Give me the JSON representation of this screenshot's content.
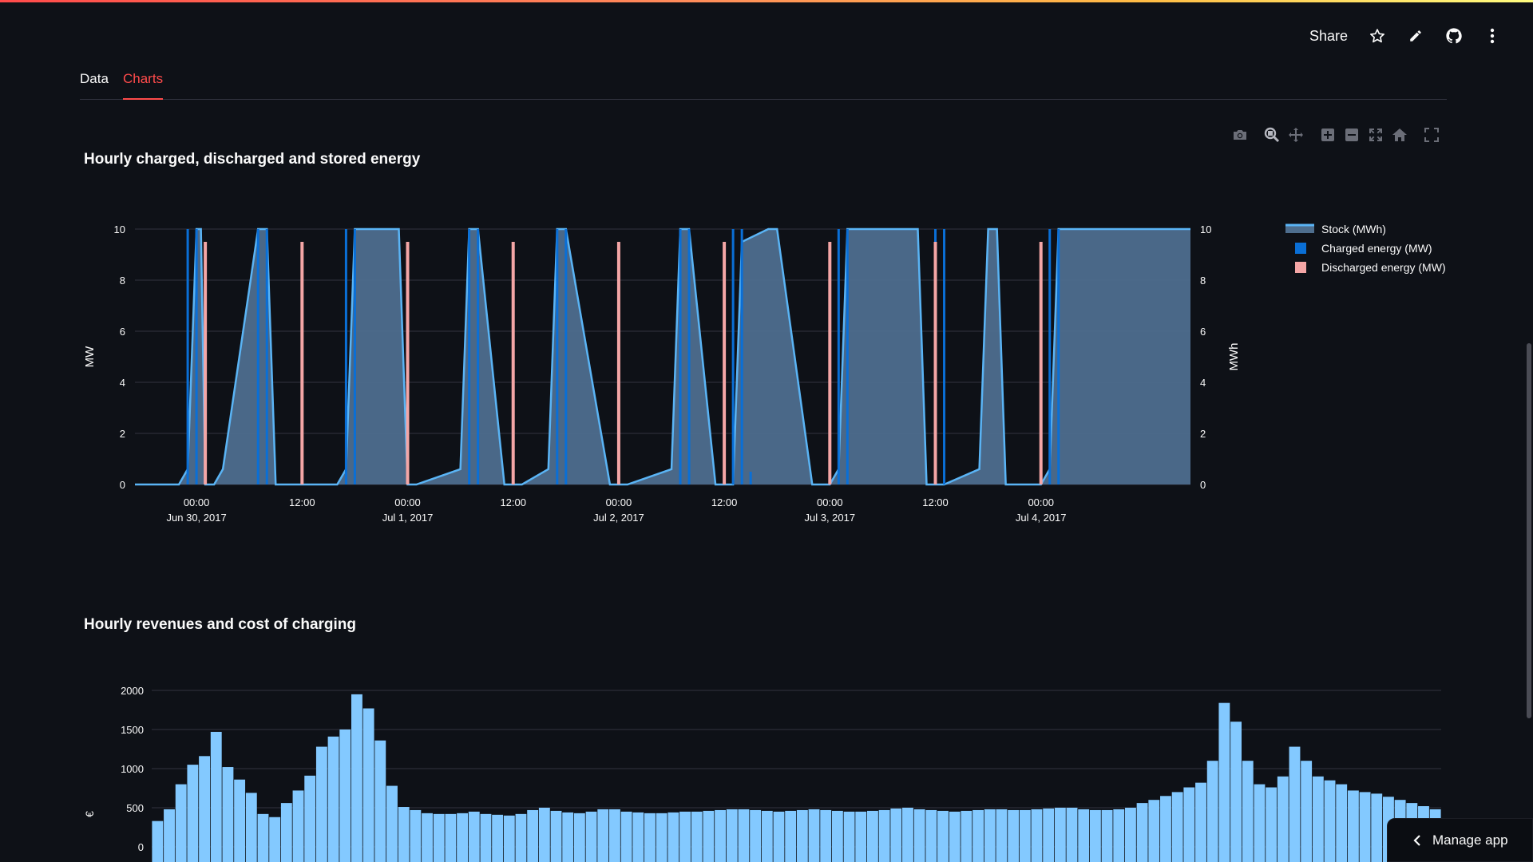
{
  "header": {
    "share_label": "Share",
    "icons": [
      "star-icon",
      "pencil-icon",
      "github-icon",
      "more-vertical-icon"
    ]
  },
  "tabs": [
    {
      "label": "Data",
      "active": false
    },
    {
      "label": "Charts",
      "active": true
    }
  ],
  "modebar": {
    "icons": [
      "camera-icon",
      "zoom-icon",
      "pan-icon",
      "zoom-in-icon",
      "zoom-out-icon",
      "autoscale-icon",
      "home-icon",
      "fullscreen-icon"
    ]
  },
  "colors": {
    "accent": "#ff4b4b",
    "stock": "#5ab4f5",
    "stock_fill": "#4e6e8e",
    "charged": "#0a6fd6",
    "discharged": "#f4a6a6",
    "revenue_bars": "#83c9ff",
    "background": "#0e1117"
  },
  "chart_data": [
    {
      "type": "area",
      "title": "Hourly charged, discharged and stored energy",
      "ylabel": "MW",
      "y2label": "MWh",
      "ylim": [
        0,
        10
      ],
      "y2lim": [
        0,
        10
      ],
      "y_ticks": [
        "0",
        "2",
        "4",
        "6",
        "8",
        "10"
      ],
      "x_range_hours": [
        "2017-06-29 17:00",
        "2017-07-04 17:00"
      ],
      "x_ticks": [
        {
          "t": "2017-06-30 00:00",
          "label": "00:00",
          "date": "Jun 30, 2017"
        },
        {
          "t": "2017-06-30 12:00",
          "label": "12:00",
          "date": ""
        },
        {
          "t": "2017-07-01 00:00",
          "label": "00:00",
          "date": "Jul 1, 2017"
        },
        {
          "t": "2017-07-01 12:00",
          "label": "12:00",
          "date": ""
        },
        {
          "t": "2017-07-02 00:00",
          "label": "00:00",
          "date": "Jul 2, 2017"
        },
        {
          "t": "2017-07-02 12:00",
          "label": "12:00",
          "date": ""
        },
        {
          "t": "2017-07-03 00:00",
          "label": "00:00",
          "date": "Jul 3, 2017"
        },
        {
          "t": "2017-07-03 12:00",
          "label": "12:00",
          "date": ""
        },
        {
          "t": "2017-07-04 00:00",
          "label": "00:00",
          "date": "Jul 4, 2017"
        }
      ],
      "legend": {
        "position": "top-right",
        "entries": [
          "Stock (MWh)",
          "Charged energy (MW)",
          "Discharged energy (MW)"
        ]
      },
      "grid": true,
      "series": [
        {
          "name": "Stock (MWh)",
          "type": "area",
          "x": [
            "2017-06-29 17:00",
            "2017-06-29 22:00",
            "2017-06-29 23:00",
            "2017-06-30 00:00",
            "2017-06-30 00:30",
            "2017-06-30 01:00",
            "2017-06-30 02:00",
            "2017-06-30 03:00",
            "2017-06-30 07:00",
            "2017-06-30 08:00",
            "2017-06-30 09:00",
            "2017-06-30 11:00",
            "2017-06-30 12:00",
            "2017-06-30 16:00",
            "2017-06-30 17:00",
            "2017-06-30 18:00",
            "2017-06-30 23:00",
            "2017-07-01 00:00",
            "2017-07-01 01:00",
            "2017-07-01 06:00",
            "2017-07-01 07:00",
            "2017-07-01 08:00",
            "2017-07-01 11:00",
            "2017-07-01 12:00",
            "2017-07-01 13:00",
            "2017-07-01 16:00",
            "2017-07-01 17:00",
            "2017-07-01 18:00",
            "2017-07-01 23:00",
            "2017-07-02 00:00",
            "2017-07-02 01:00",
            "2017-07-02 06:00",
            "2017-07-02 07:00",
            "2017-07-02 08:00",
            "2017-07-02 11:00",
            "2017-07-02 12:00",
            "2017-07-02 13:00",
            "2017-07-02 14:00",
            "2017-07-02 17:00",
            "2017-07-02 18:00",
            "2017-07-02 22:00",
            "2017-07-02 23:00",
            "2017-07-03 00:00",
            "2017-07-03 01:00",
            "2017-07-03 02:00",
            "2017-07-03 10:00",
            "2017-07-03 11:00",
            "2017-07-03 12:00",
            "2017-07-03 13:00",
            "2017-07-03 17:00",
            "2017-07-03 18:00",
            "2017-07-03 19:00",
            "2017-07-03 20:00",
            "2017-07-04 00:00",
            "2017-07-04 01:00",
            "2017-07-04 02:00",
            "2017-07-04 17:00"
          ],
          "values": [
            0,
            0,
            0.6,
            10,
            10,
            0,
            0,
            0.6,
            10,
            10,
            0,
            0,
            0,
            0,
            0.6,
            10,
            10,
            0,
            0,
            0.6,
            10,
            10,
            0,
            0,
            0,
            0.6,
            10,
            10,
            0,
            0,
            0,
            0.6,
            10,
            10,
            0,
            0,
            0,
            9.5,
            10,
            10,
            0,
            0,
            0,
            0.6,
            10,
            10,
            0,
            0,
            0,
            0.6,
            10,
            10,
            0,
            0,
            0.6,
            10,
            10
          ]
        },
        {
          "name": "Charged energy (MW)",
          "type": "bar",
          "x": [
            "2017-06-29 23:00",
            "2017-06-30 00:00",
            "2017-06-30 07:00",
            "2017-06-30 08:00",
            "2017-06-30 17:00",
            "2017-06-30 18:00",
            "2017-07-01 07:00",
            "2017-07-01 08:00",
            "2017-07-01 17:00",
            "2017-07-01 18:00",
            "2017-07-02 07:00",
            "2017-07-02 08:00",
            "2017-07-02 13:00",
            "2017-07-02 14:00",
            "2017-07-02 15:00",
            "2017-07-03 01:00",
            "2017-07-03 02:00",
            "2017-07-03 12:00",
            "2017-07-03 13:00",
            "2017-07-04 01:00",
            "2017-07-04 02:00"
          ],
          "values": [
            10,
            10,
            10,
            10,
            10,
            10,
            10,
            10,
            10,
            10,
            10,
            10,
            10,
            10,
            0.5,
            10,
            10,
            10,
            10,
            10,
            10
          ]
        },
        {
          "name": "Discharged energy (MW)",
          "type": "bar",
          "x": [
            "2017-06-30 01:00",
            "2017-06-30 12:00",
            "2017-07-01 00:00",
            "2017-07-01 12:00",
            "2017-07-02 00:00",
            "2017-07-02 12:00",
            "2017-07-03 00:00",
            "2017-07-03 12:00",
            "2017-07-04 00:00"
          ],
          "values": [
            9.5,
            9.5,
            9.5,
            9.5,
            9.5,
            9.5,
            9.5,
            9.5,
            9.5
          ]
        }
      ]
    },
    {
      "type": "bar",
      "title": "Hourly revenues and cost of charging",
      "ylabel": "€",
      "y_ticks": [
        "0",
        "500",
        "1000",
        "1500",
        "2000"
      ],
      "ylim_visible": [
        -270,
        2000
      ],
      "grid": true,
      "series": [
        {
          "name": "",
          "values": [
            330,
            480,
            800,
            1050,
            1160,
            1470,
            1020,
            860,
            690,
            420,
            380,
            560,
            720,
            910,
            1280,
            1410,
            1500,
            1950,
            1770,
            1360,
            780,
            510,
            470,
            430,
            420,
            420,
            430,
            450,
            420,
            410,
            400,
            420,
            470,
            500,
            460,
            440,
            430,
            450,
            480,
            480,
            450,
            440,
            430,
            430,
            440,
            450,
            450,
            460,
            470,
            480,
            480,
            470,
            460,
            450,
            460,
            470,
            480,
            470,
            460,
            450,
            450,
            460,
            470,
            490,
            500,
            480,
            470,
            460,
            450,
            460,
            470,
            480,
            480,
            470,
            470,
            480,
            490,
            500,
            500,
            480,
            470,
            470,
            480,
            500,
            560,
            600,
            650,
            700,
            760,
            820,
            1100,
            1840,
            1600,
            1100,
            800,
            760,
            900,
            1280,
            1100,
            900,
            850,
            800,
            720,
            700,
            680,
            640,
            600,
            560,
            520,
            480
          ]
        }
      ]
    }
  ],
  "manage_app": {
    "label": "Manage app"
  }
}
